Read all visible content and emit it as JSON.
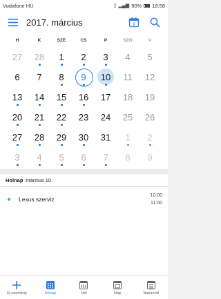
{
  "status_bar": {
    "carrier": "Vodafone HU",
    "battery": "90%",
    "time": "18:58"
  },
  "app_bar": {
    "title": "2017. március",
    "today_day": "9"
  },
  "weekdays": [
    {
      "label": "H",
      "weekend": false
    },
    {
      "label": "K",
      "weekend": false
    },
    {
      "label": "SZE",
      "weekend": false
    },
    {
      "label": "CS",
      "weekend": false
    },
    {
      "label": "P",
      "weekend": false
    },
    {
      "label": "SZO",
      "weekend": true
    },
    {
      "label": "V",
      "weekend": true
    }
  ],
  "weeks": [
    [
      {
        "day": "27",
        "other": true,
        "dot": ""
      },
      {
        "day": "28",
        "other": true,
        "dot": "blue"
      },
      {
        "day": "1",
        "other": false,
        "dot": "blue"
      },
      {
        "day": "2",
        "other": false,
        "dot": "blue"
      },
      {
        "day": "3",
        "other": false,
        "dot": "blue"
      },
      {
        "day": "4",
        "other": false,
        "dot": ""
      },
      {
        "day": "5",
        "other": false,
        "dot": ""
      }
    ],
    [
      {
        "day": "6",
        "other": false,
        "dot": ""
      },
      {
        "day": "7",
        "other": false,
        "dot": ""
      },
      {
        "day": "8",
        "other": false,
        "dot": "blue"
      },
      {
        "day": "9",
        "other": false,
        "dot": "blue",
        "today": true
      },
      {
        "day": "10",
        "other": false,
        "dot": "blue",
        "selected": true
      },
      {
        "day": "11",
        "other": false,
        "dot": ""
      },
      {
        "day": "12",
        "other": false,
        "dot": ""
      }
    ],
    [
      {
        "day": "13",
        "other": false,
        "dot": "blue"
      },
      {
        "day": "14",
        "other": false,
        "dot": "blue"
      },
      {
        "day": "15",
        "other": false,
        "dot": "blue"
      },
      {
        "day": "16",
        "other": false,
        "dot": "blue"
      },
      {
        "day": "17",
        "other": false,
        "dot": ""
      },
      {
        "day": "18",
        "other": false,
        "dot": ""
      },
      {
        "day": "19",
        "other": false,
        "dot": ""
      }
    ],
    [
      {
        "day": "20",
        "other": false,
        "dot": "blue"
      },
      {
        "day": "21",
        "other": false,
        "dot": "blue"
      },
      {
        "day": "22",
        "other": false,
        "dot": "blue"
      },
      {
        "day": "23",
        "other": false,
        "dot": ""
      },
      {
        "day": "24",
        "other": false,
        "dot": ""
      },
      {
        "day": "25",
        "other": false,
        "dot": ""
      },
      {
        "day": "26",
        "other": false,
        "dot": ""
      }
    ],
    [
      {
        "day": "27",
        "other": false,
        "dot": "blue"
      },
      {
        "day": "28",
        "other": false,
        "dot": "blue"
      },
      {
        "day": "29",
        "other": false,
        "dot": "blue"
      },
      {
        "day": "30",
        "other": false,
        "dot": "blue"
      },
      {
        "day": "31",
        "other": false,
        "dot": ""
      },
      {
        "day": "1",
        "other": true,
        "dot": "pink"
      },
      {
        "day": "2",
        "other": true,
        "dot": "pink"
      }
    ],
    [
      {
        "day": "3",
        "other": true,
        "dot": "blue"
      },
      {
        "day": "4",
        "other": true,
        "dot": "blue"
      },
      {
        "day": "5",
        "other": true,
        "dot": "blue"
      },
      {
        "day": "6",
        "other": true,
        "dot": "blue"
      },
      {
        "day": "7",
        "other": true,
        "dot": "blue"
      },
      {
        "day": "8",
        "other": true,
        "dot": ""
      },
      {
        "day": "9",
        "other": true,
        "dot": ""
      }
    ]
  ],
  "agenda": {
    "header_label": "Holnap",
    "header_date": "március 10.",
    "events": [
      {
        "title": "Lexus szerviz",
        "start": "10:00",
        "end": "11:00",
        "color": "#2fbf71"
      }
    ]
  },
  "bottom_nav": [
    {
      "label": "Új esemény",
      "icon": "plus-icon",
      "active": false
    },
    {
      "label": "Hónap",
      "icon": "month-grid-icon",
      "active": true
    },
    {
      "label": "Hét",
      "icon": "week-icon",
      "active": false
    },
    {
      "label": "Nap",
      "icon": "day-icon",
      "active": false
    },
    {
      "label": "Napirend",
      "icon": "agenda-icon",
      "active": false
    }
  ],
  "colors": {
    "accent": "#2b7de0",
    "selected_bg": "#cfe3f8",
    "event_dot": "#1e6fd9",
    "holiday_dot": "#e85a93"
  }
}
